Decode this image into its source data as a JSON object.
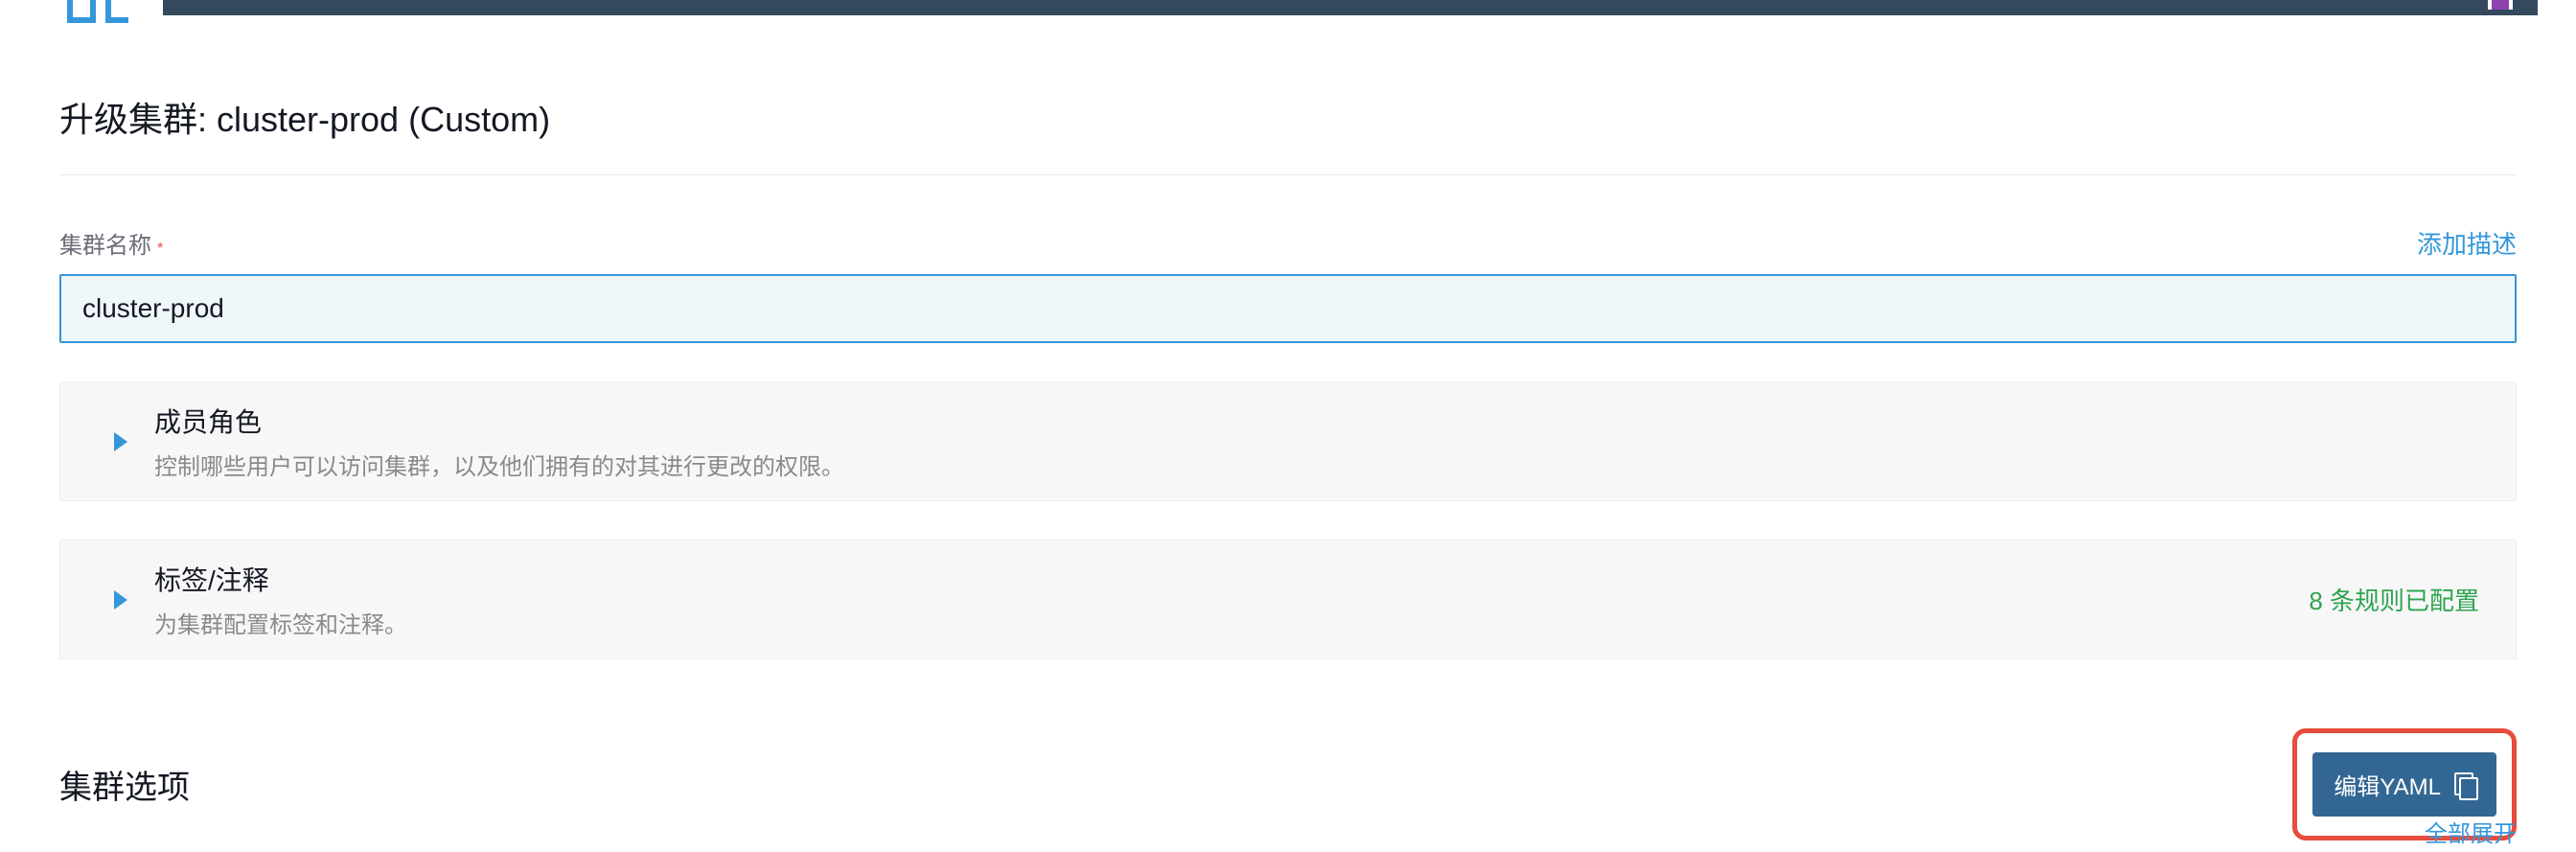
{
  "page": {
    "title": "升级集群: cluster-prod (Custom)"
  },
  "clusterName": {
    "label": "集群名称",
    "value": "cluster-prod"
  },
  "actions": {
    "addDescription": "添加描述",
    "editYaml": "编辑YAML",
    "expandAll": "全部展开"
  },
  "sections": {
    "memberRoles": {
      "title": "成员角色",
      "desc": "控制哪些用户可以访问集群，以及他们拥有的对其进行更改的权限。"
    },
    "labelsAnnotations": {
      "title": "标签/注释",
      "desc": "为集群配置标签和注释。",
      "status": "8 条规则已配置"
    },
    "clusterOptions": {
      "title": "集群选项"
    }
  }
}
